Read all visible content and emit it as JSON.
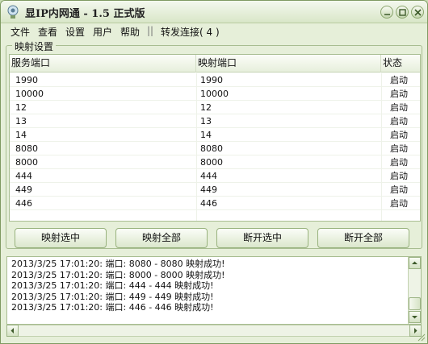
{
  "window": {
    "title": "显IP内网通 - 1.5 正式版"
  },
  "menu": {
    "items": [
      "文件",
      "查看",
      "设置",
      "用户",
      "帮助"
    ],
    "separator": "||",
    "status": "转发连接( 4 )"
  },
  "mapping": {
    "group_label": "映射设置",
    "columns": [
      "服务端口",
      "映射端口",
      "状态"
    ],
    "rows": [
      {
        "service": "1990",
        "mapped": "1990",
        "status": "启动"
      },
      {
        "service": "10000",
        "mapped": "10000",
        "status": "启动"
      },
      {
        "service": "12",
        "mapped": "12",
        "status": "启动"
      },
      {
        "service": "13",
        "mapped": "13",
        "status": "启动"
      },
      {
        "service": "14",
        "mapped": "14",
        "status": "启动"
      },
      {
        "service": "8080",
        "mapped": "8080",
        "status": "启动"
      },
      {
        "service": "8000",
        "mapped": "8000",
        "status": "启动"
      },
      {
        "service": "444",
        "mapped": "444",
        "status": "启动"
      },
      {
        "service": "449",
        "mapped": "449",
        "status": "启动"
      },
      {
        "service": "446",
        "mapped": "446",
        "status": "启动"
      }
    ]
  },
  "buttons": {
    "map_selected": "映射选中",
    "map_all": "映射全部",
    "disconnect_selected": "断开选中",
    "disconnect_all": "断开全部"
  },
  "log": {
    "lines": [
      "2013/3/25 17:01:20: 端口: 8080 - 8080 映射成功!",
      "2013/3/25 17:01:20: 端口: 8000 - 8000 映射成功!",
      "2013/3/25 17:01:20: 端口: 444 - 444 映射成功!",
      "2013/3/25 17:01:20: 端口: 449 - 449 映射成功!",
      "2013/3/25 17:01:20: 端口: 446 - 446 映射成功!"
    ]
  },
  "colors": {
    "theme_green": "#e6efd9",
    "border_green": "#a8bd91"
  },
  "icons": {
    "app": "app-icon",
    "minimize": "minimize-icon",
    "maximize": "maximize-icon",
    "close": "close-icon"
  }
}
